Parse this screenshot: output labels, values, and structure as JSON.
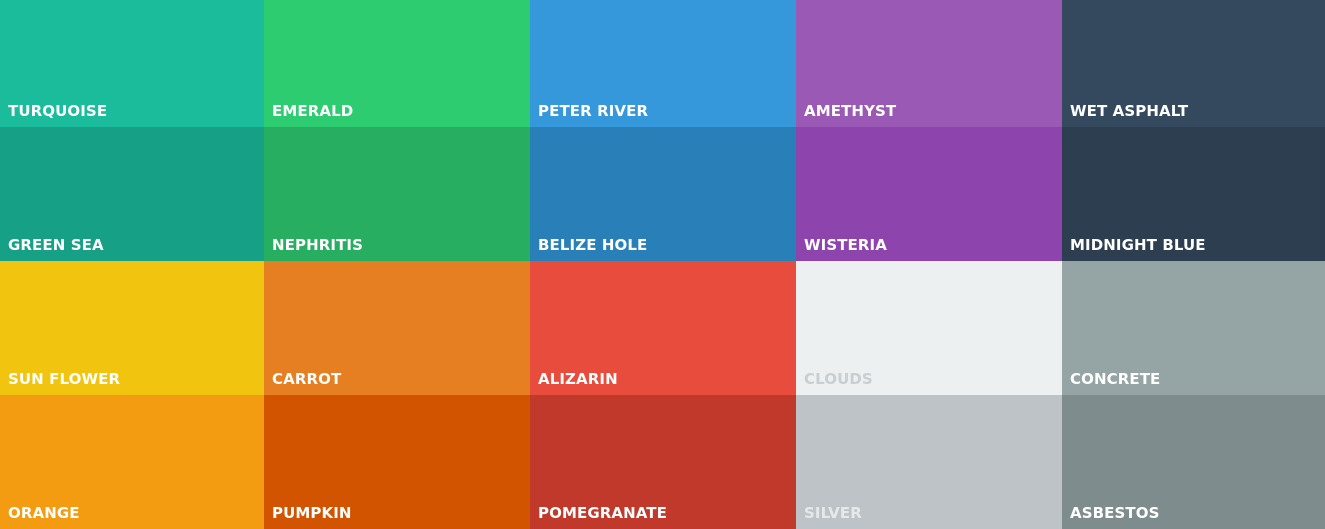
{
  "swatches": [
    {
      "name": "TURQUOISE",
      "color": "#1abc9c"
    },
    {
      "name": "EMERALD",
      "color": "#2ecc71"
    },
    {
      "name": "PETER RIVER",
      "color": "#3498db"
    },
    {
      "name": "AMETHYST",
      "color": "#9b59b6"
    },
    {
      "name": "WET ASPHALT",
      "color": "#34495e"
    },
    {
      "name": "GREEN SEA",
      "color": "#16a085"
    },
    {
      "name": "NEPHRITIS",
      "color": "#27ae60"
    },
    {
      "name": "BELIZE HOLE",
      "color": "#2980b9"
    },
    {
      "name": "WISTERIA",
      "color": "#8e44ad"
    },
    {
      "name": "MIDNIGHT BLUE",
      "color": "#2c3e50"
    },
    {
      "name": "SUN FLOWER",
      "color": "#f1c40f"
    },
    {
      "name": "CARROT",
      "color": "#e67e22"
    },
    {
      "name": "ALIZARIN",
      "color": "#e74c3c"
    },
    {
      "name": "CLOUDS",
      "color": "#ecf0f1"
    },
    {
      "name": "CONCRETE",
      "color": "#95a5a6"
    },
    {
      "name": "ORANGE",
      "color": "#f39c12"
    },
    {
      "name": "PUMPKIN",
      "color": "#d35400"
    },
    {
      "name": "POMEGRANATE",
      "color": "#c0392b"
    },
    {
      "name": "SILVER",
      "color": "#bdc3c7"
    },
    {
      "name": "ASBESTOS",
      "color": "#7f8c8d"
    }
  ]
}
